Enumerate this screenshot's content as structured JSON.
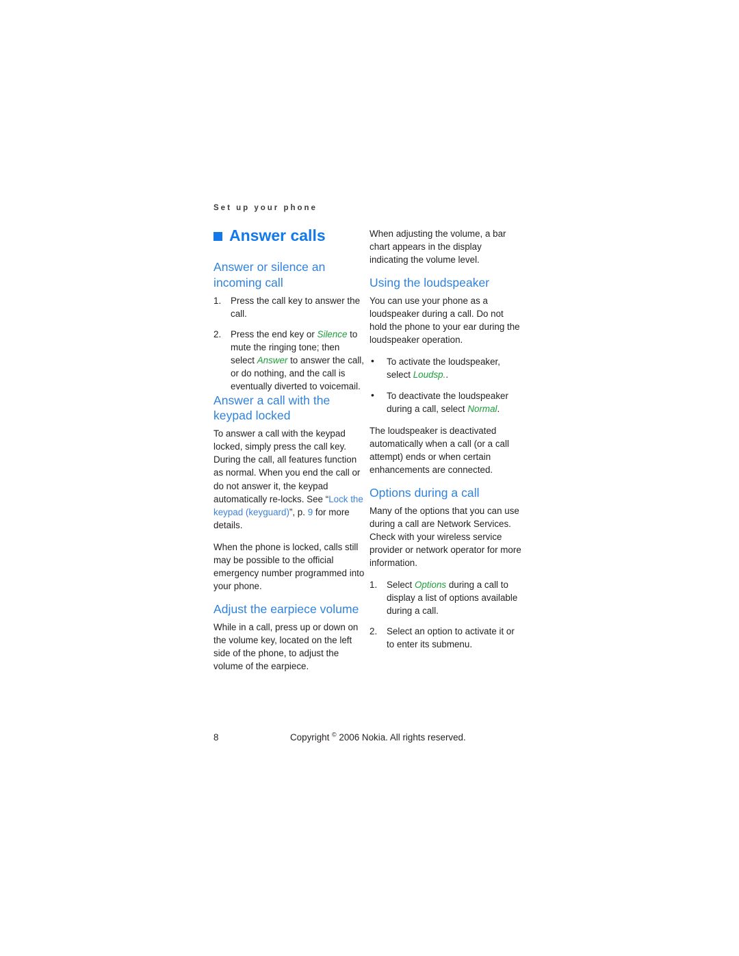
{
  "page": {
    "running_header": "Set up your phone",
    "folio": "8",
    "copyright_before": "Copyright ",
    "copyright_symbol": "©",
    "copyright_after": " 2006 Nokia. All rights reserved.",
    "colors": {
      "chapter_blue": "#1479E8",
      "heading_blue": "#2F82DC",
      "link_blue": "#3C82D8",
      "ui_term_green": "#1E9E3A",
      "body_black": "#231F20",
      "background": "#FFFFFF"
    }
  },
  "left_column": {
    "chapter_title": "Answer calls",
    "section_1": {
      "heading": "Answer or silence an incoming call",
      "steps": [
        {
          "number": "1.",
          "parts": [
            {
              "text": "Press the call key to answer the call."
            }
          ]
        },
        {
          "number": "2.",
          "parts": [
            {
              "text": "Press the end key or "
            },
            {
              "text": "Silence",
              "style": "ui-term"
            },
            {
              "text": " to mute the ringing tone; then select "
            },
            {
              "text": "Answer",
              "style": "ui-term"
            },
            {
              "text": " to answer the call, or do nothing, and the call is eventually diverted to voicemail."
            }
          ]
        }
      ]
    },
    "section_2": {
      "heading": "Answer a call with the keypad locked",
      "paragraph_1_parts": [
        {
          "text": "To answer a call with the keypad locked, simply press the call key. During the call, all features function as normal. When you end the call or do not answer it, the keypad automatically re-locks. See “"
        },
        {
          "text": "Lock the keypad (keyguard)",
          "style": "xlink"
        },
        {
          "text": "”, p. "
        },
        {
          "text": "9",
          "style": "xlink"
        },
        {
          "text": " for more details."
        }
      ],
      "paragraph_2": "When the phone is locked, calls still may be possible to the official emergency number programmed into your phone."
    },
    "section_3": {
      "heading": "Adjust the earpiece volume",
      "paragraph_1": "While in a call, press up or down on the volume key, located on the left side of the phone, to adjust the volume of the earpiece."
    }
  },
  "right_column": {
    "intro_paragraph": "When adjusting the volume, a bar chart appears in the display indicating the volume level.",
    "section_1": {
      "heading": "Using the loudspeaker",
      "paragraph_1": "You can use your phone as a loudspeaker during a call. Do not hold the phone to your ear during the loudspeaker operation.",
      "bullets": [
        {
          "marker": "•",
          "parts": [
            {
              "text": "To activate the loudspeaker, select "
            },
            {
              "text": "Loudsp.",
              "style": "ui-term"
            },
            {
              "text": "."
            }
          ]
        },
        {
          "marker": "•",
          "parts": [
            {
              "text": "To deactivate the loudspeaker during a call, select "
            },
            {
              "text": "Normal",
              "style": "ui-term"
            },
            {
              "text": "."
            }
          ]
        }
      ],
      "paragraph_2": "The loudspeaker is deactivated automatically when a call (or a call attempt) ends or when certain enhancements are connected."
    },
    "section_2": {
      "heading": "Options during a call",
      "paragraph_1": "Many of the options that you can use during a call are Network Services. Check with your wireless service provider or network operator for more information.",
      "steps": [
        {
          "number": "1.",
          "parts": [
            {
              "text": "Select "
            },
            {
              "text": "Options",
              "style": "ui-term"
            },
            {
              "text": " during a call to display a list of options available during a call."
            }
          ]
        },
        {
          "number": "2.",
          "parts": [
            {
              "text": "Select an option to activate it or to enter its submenu."
            }
          ]
        }
      ]
    }
  }
}
